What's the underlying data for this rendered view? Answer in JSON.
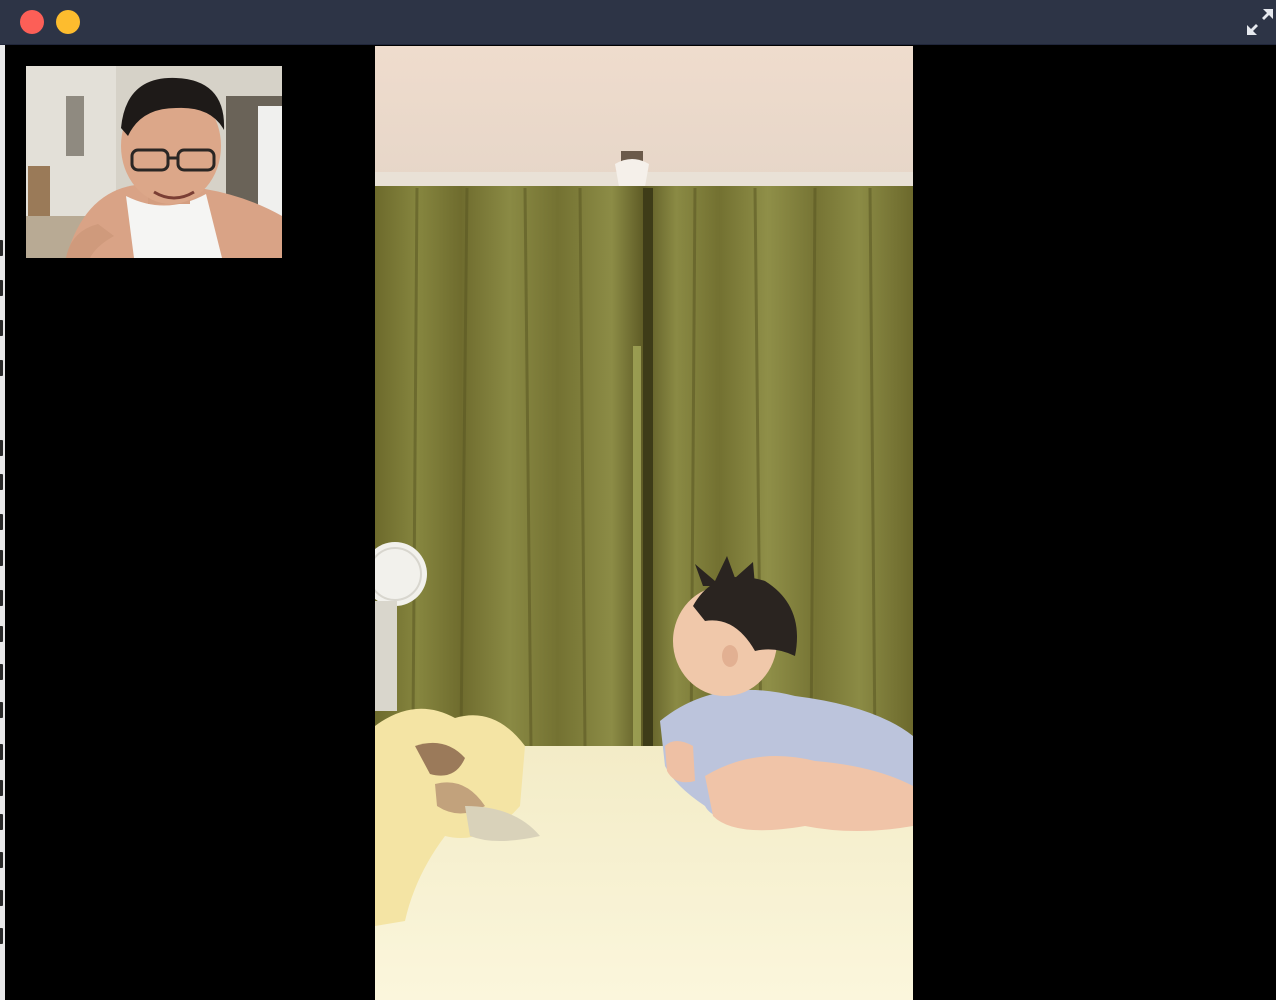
{
  "window": {
    "controls": {
      "close_icon": "close-icon",
      "minimize_icon": "minimize-icon",
      "fullscreen_icon": "expand-arrows-icon"
    },
    "colors": {
      "titlebar": "#2d3446",
      "close": "#fc5f57",
      "minimize": "#fdbc2e",
      "background": "#000000"
    }
  },
  "call": {
    "remote_feed": "remote-video",
    "self_feed": "self-view"
  }
}
